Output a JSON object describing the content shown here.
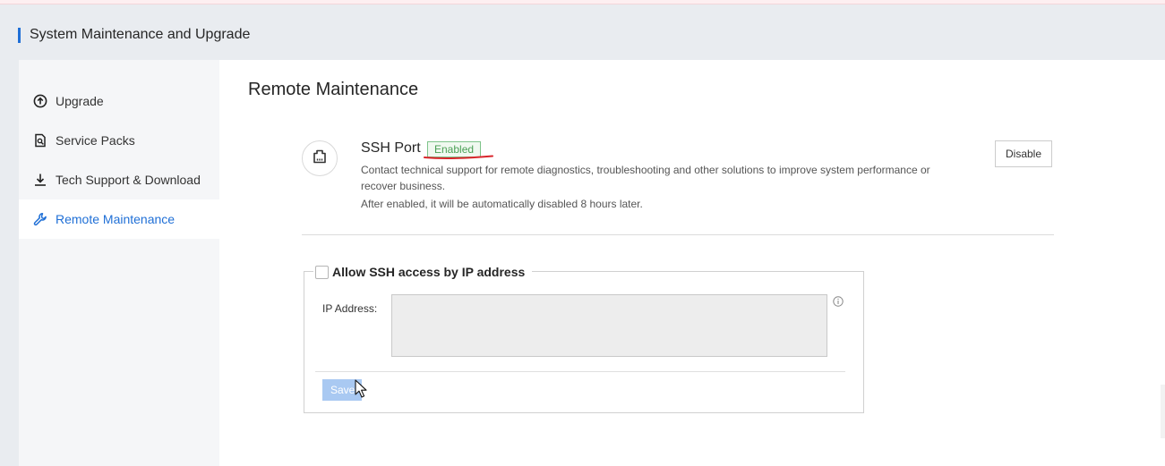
{
  "page_header": {
    "title": "System Maintenance and Upgrade"
  },
  "sidebar": {
    "items": [
      {
        "label": "Upgrade",
        "icon": "upload-circle-icon",
        "active": false
      },
      {
        "label": "Service Packs",
        "icon": "document-search-icon",
        "active": false
      },
      {
        "label": "Tech Support & Download",
        "icon": "download-icon",
        "active": false
      },
      {
        "label": "Remote Maintenance",
        "icon": "wrench-icon",
        "active": true
      }
    ]
  },
  "main": {
    "title": "Remote Maintenance",
    "ssh": {
      "title": "SSH Port",
      "badge": "Enabled",
      "description": "Contact technical support for remote diagnostics, troubleshooting and other solutions to improve system performance or recover business.",
      "note": "After enabled, it will be automatically disabled 8 hours later.",
      "disable_label": "Disable"
    },
    "ip_access": {
      "legend": "Allow SSH access by IP address",
      "checked": false,
      "ip_label": "IP Address:",
      "ip_value": "",
      "save_label": "Save"
    }
  },
  "colors": {
    "accent": "#1f6fd6",
    "badge_green": "#4a9f55",
    "annotation_red": "#d9262c",
    "save_disabled": "#a9c9f2"
  }
}
